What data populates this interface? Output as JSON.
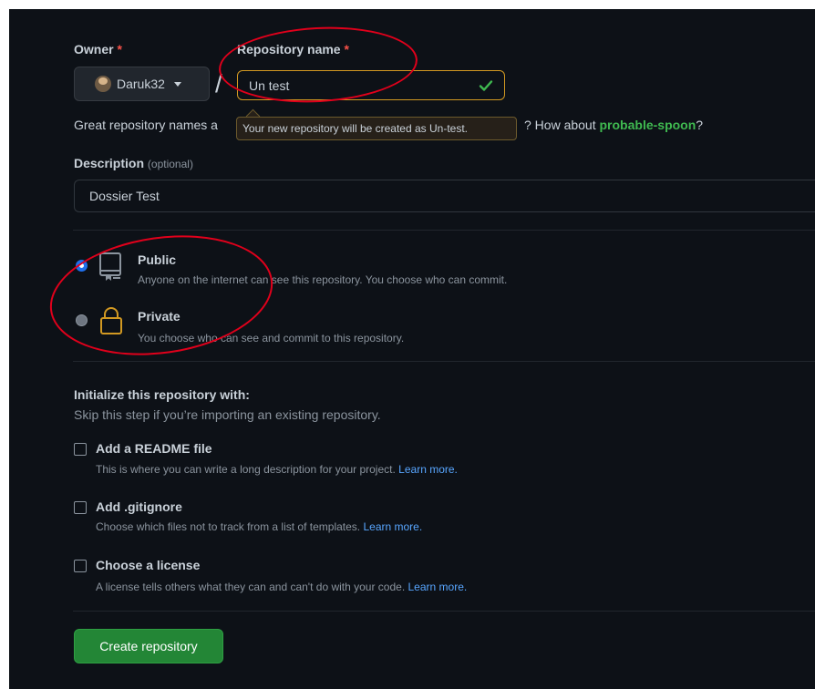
{
  "owner": {
    "label": "Owner",
    "required_mark": "*",
    "selected": "Daruk32"
  },
  "repo_name": {
    "label": "Repository name",
    "required_mark": "*",
    "separator": "/",
    "value": "Un test",
    "hint_prefix": "Great repository names a",
    "hint_suffix": "? How about",
    "suggestion": "probable-spoon",
    "suggestion_end": "?",
    "tooltip": "Your new repository will be created as Un-test."
  },
  "description": {
    "label": "Description",
    "optional": "(optional)",
    "value": "Dossier Test"
  },
  "visibility": {
    "public_title": "Public",
    "public_desc": "Anyone on the internet can see this repository. You choose who can commit.",
    "private_title": "Private",
    "private_desc": "You choose who can see and commit to this repository.",
    "selected": "Public"
  },
  "init": {
    "title": "Initialize this repository with:",
    "subtitle": "Skip this step if you’re importing an existing repository.",
    "readme_label": "Add a README file",
    "readme_desc": "This is where you can write a long description for your project.",
    "gitignore_label": "Add .gitignore",
    "gitignore_desc": "Choose which files not to track from a list of templates.",
    "license_label": "Choose a license",
    "license_desc": "A license tells others what they can and can't do with your code.",
    "learn_more": "Learn more."
  },
  "create_button": "Create repository",
  "colors": {
    "background": "#0d1117",
    "primary_button": "#238636",
    "link": "#58a6ff",
    "annotation": "#e0001b",
    "warning_border": "#d29922"
  }
}
